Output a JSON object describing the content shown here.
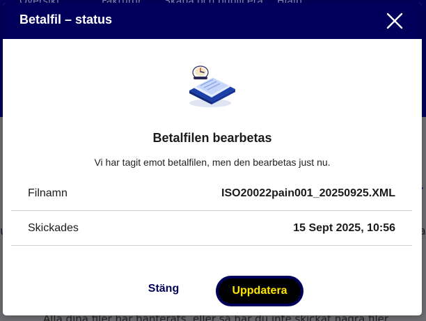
{
  "background": {
    "nav_items": [
      "Översikt",
      "Fakturor",
      "Skapa och publicera",
      "Hjälp"
    ],
    "footer_text": "Alla dina filer har hanterats, eller så har du inte skickat några filer."
  },
  "modal": {
    "title": "Betalfil – status",
    "close_icon": "close-x-icon",
    "illustration_icon": "document-with-clock-icon",
    "heading": "Betalfilen bearbetas",
    "message": "Vi har tagit emot betalfilen, men den bearbetas just nu.",
    "details": [
      {
        "label": "Filnamn",
        "value": "ISO20022pain001_20250925.XML"
      },
      {
        "label": "Skickades",
        "value": "15 Sept 2025, 10:56"
      }
    ],
    "buttons": {
      "close_label": "Stäng",
      "update_label": "Uppdatera"
    }
  },
  "colors": {
    "brand_navy": "#00005a",
    "button_text_yellow": "#ffe600",
    "overlay": "#7a7a80"
  }
}
